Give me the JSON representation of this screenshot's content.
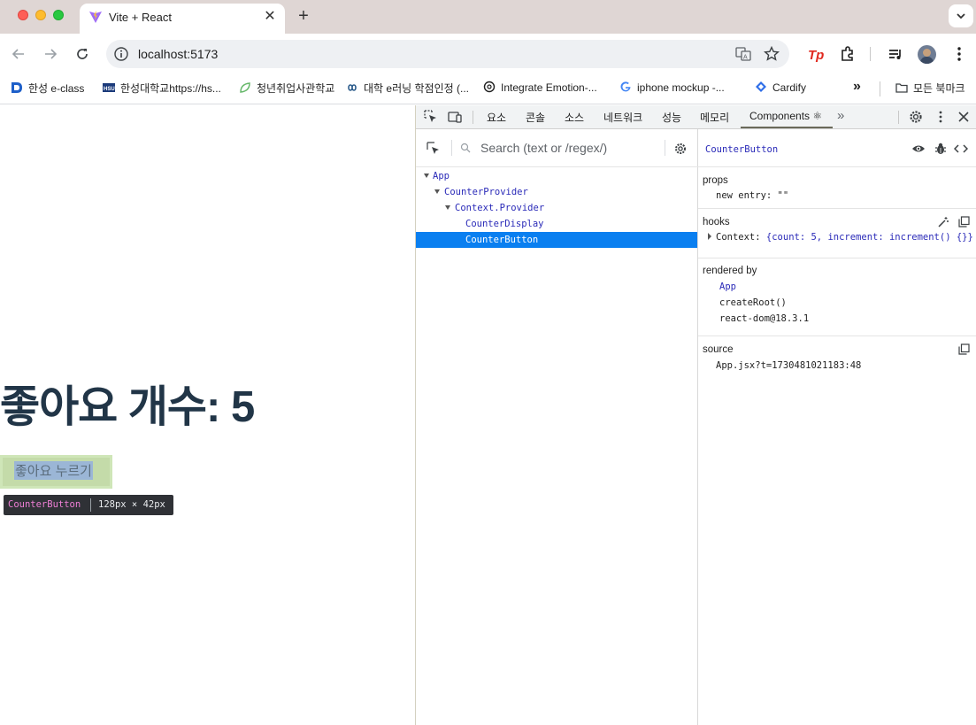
{
  "browser": {
    "tab_title": "Vite + React",
    "url": "localhost:5173",
    "bookmarks": [
      {
        "label": "한성 e-class"
      },
      {
        "label": "한성대학교https://hs..."
      },
      {
        "label": "청년취업사관학교"
      },
      {
        "label": "대학 e러닝 학점인정 (..."
      },
      {
        "label": "Integrate Emotion-..."
      },
      {
        "label": "iphone mockup -..."
      },
      {
        "label": "Cardify"
      }
    ],
    "all_bookmarks": "모든 북마크"
  },
  "page": {
    "heading": "좋아요 개수: 5",
    "button_label": "좋아요 누르기",
    "inspect_tip": {
      "name": "CounterButton",
      "size": "128px × 42px"
    }
  },
  "devtools": {
    "tabs": [
      "요소",
      "콘솔",
      "소스",
      "네트워크",
      "성능",
      "메모리",
      "Components ⚛"
    ],
    "active_tab": "Components ⚛",
    "search_placeholder": "Search (text or /regex/)",
    "tree": [
      {
        "label": "App",
        "expanded": true
      },
      {
        "label": "CounterProvider",
        "expanded": true
      },
      {
        "label": "Context.Provider",
        "expanded": true
      },
      {
        "label": "CounterDisplay",
        "expanded": false
      },
      {
        "label": "CounterButton",
        "expanded": false,
        "selected": true
      }
    ],
    "inspector": {
      "component": "CounterButton",
      "props_heading": "props",
      "props_entry_key": "new entry:",
      "props_entry_value": "\"\"",
      "hooks_heading": "hooks",
      "hooks_key": "Context:",
      "hooks_value": "{count: 5, increment: increment() {}}",
      "rendered_by_heading": "rendered by",
      "rendered_by": [
        "App",
        "createRoot()",
        "react-dom@18.3.1"
      ],
      "source_heading": "source",
      "source_value": "App.jsx?t=1730481021183:48"
    }
  },
  "colors": {
    "heading": "#213547",
    "selection": "#0a7ff0",
    "component_name": "#2a2ab8"
  }
}
